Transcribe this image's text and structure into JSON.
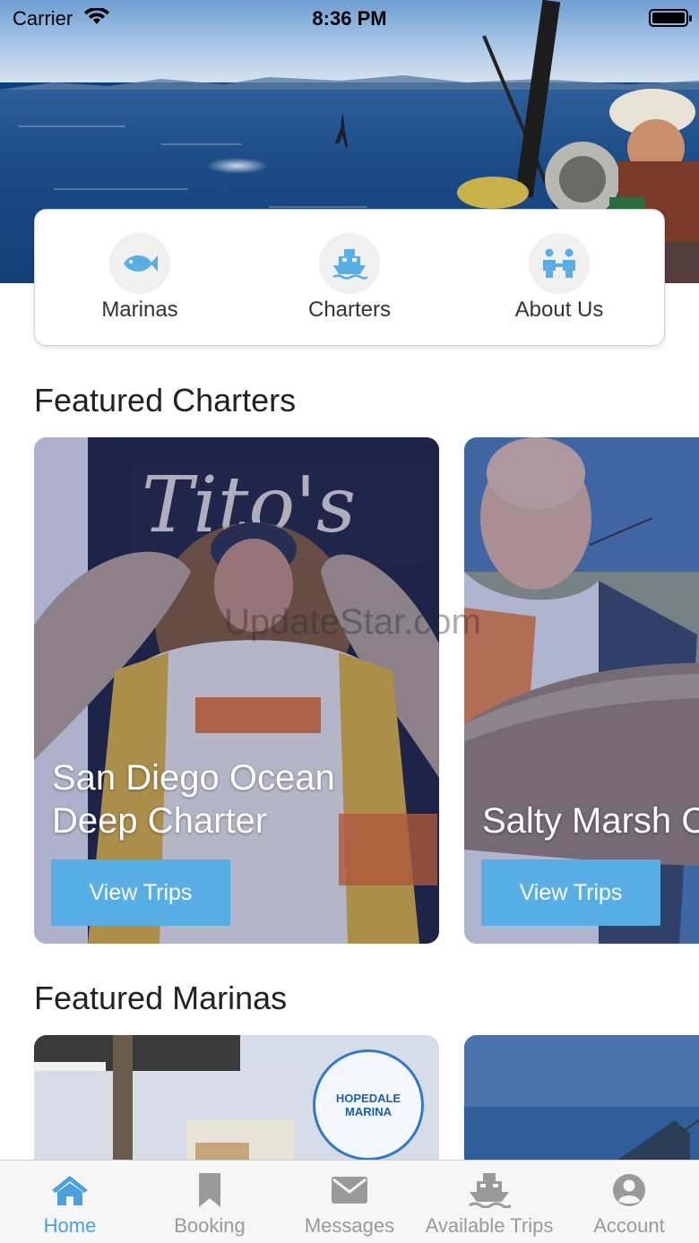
{
  "status_bar": {
    "carrier": "Carrier",
    "time": "8:36 PM"
  },
  "quick_menu": {
    "items": [
      {
        "label": "Marinas",
        "icon": "fish-icon"
      },
      {
        "label": "Charters",
        "icon": "boat-icon"
      },
      {
        "label": "About Us",
        "icon": "people-icon"
      }
    ]
  },
  "featured_charters": {
    "title": "Featured Charters",
    "cards": [
      {
        "name": "San Diego Ocean Deep Charter",
        "button": "View Trips"
      },
      {
        "name": "Salty Marsh C",
        "button": "View Trips"
      }
    ]
  },
  "featured_marinas": {
    "title": "Featured Marinas",
    "cards": [
      {
        "logo_text": "HOPEDALE MARINA"
      },
      {
        "logo_text": ""
      }
    ]
  },
  "watermark": "UpdateStar.com",
  "tab_bar": {
    "active": "Home",
    "tabs": [
      {
        "label": "Home",
        "icon": "home-icon"
      },
      {
        "label": "Booking",
        "icon": "bookmark-icon"
      },
      {
        "label": "Messages",
        "icon": "envelope-icon"
      },
      {
        "label": "Available Trips",
        "icon": "ship-icon"
      },
      {
        "label": "Account",
        "icon": "account-icon"
      }
    ]
  },
  "colors": {
    "accent": "#4aa1dd",
    "button": "#5aaee6",
    "icon_blue": "#5aaee6",
    "tab_inactive": "#9a9a9a"
  }
}
